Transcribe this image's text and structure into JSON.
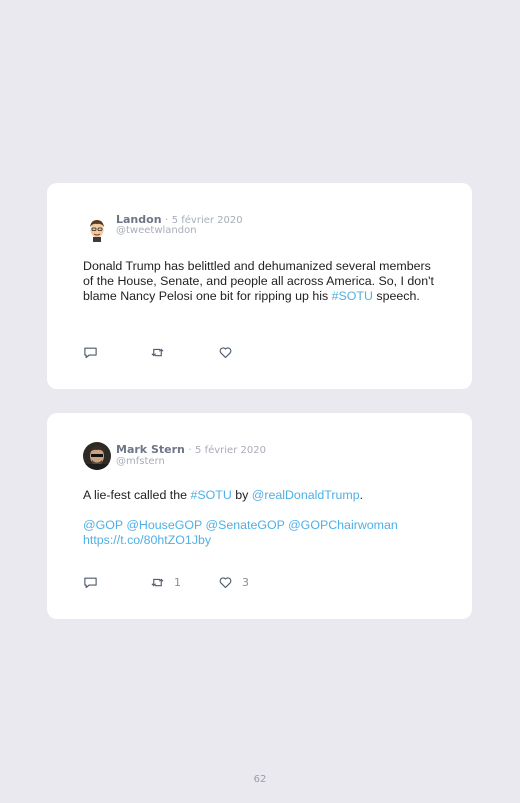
{
  "tweets": [
    {
      "name": "Landon",
      "date": "5 février 2020",
      "handle": "@tweetwlandon",
      "text": "Donald Trump has belittled and dehumanized several members of the House, Senate, and people all across America. So, I don't blame Nancy Pelosi one bit for ripping up his ",
      "hashtag": "#SOTU",
      "text_end": " speech.",
      "retweets": "",
      "likes": ""
    },
    {
      "name": "Mark Stern",
      "date": "5 février 2020",
      "handle": "@mfstern",
      "text_a": "A lie-fest called the ",
      "hashtag": "#SOTU",
      "text_b": " by ",
      "mention": "@realDonaldTrump",
      "text_c": ".",
      "mentions_line": "@GOP @HouseGOP @SenateGOP @GOPChairwoman",
      "url": "https://t.co/80htZO1Jby",
      "retweets": "1",
      "likes": "3"
    }
  ],
  "page_number": "62",
  "colors": {
    "link": "#4fb0e6",
    "background": "#e9e9ef"
  },
  "icons": [
    "reply-icon",
    "retweet-icon",
    "like-icon"
  ]
}
